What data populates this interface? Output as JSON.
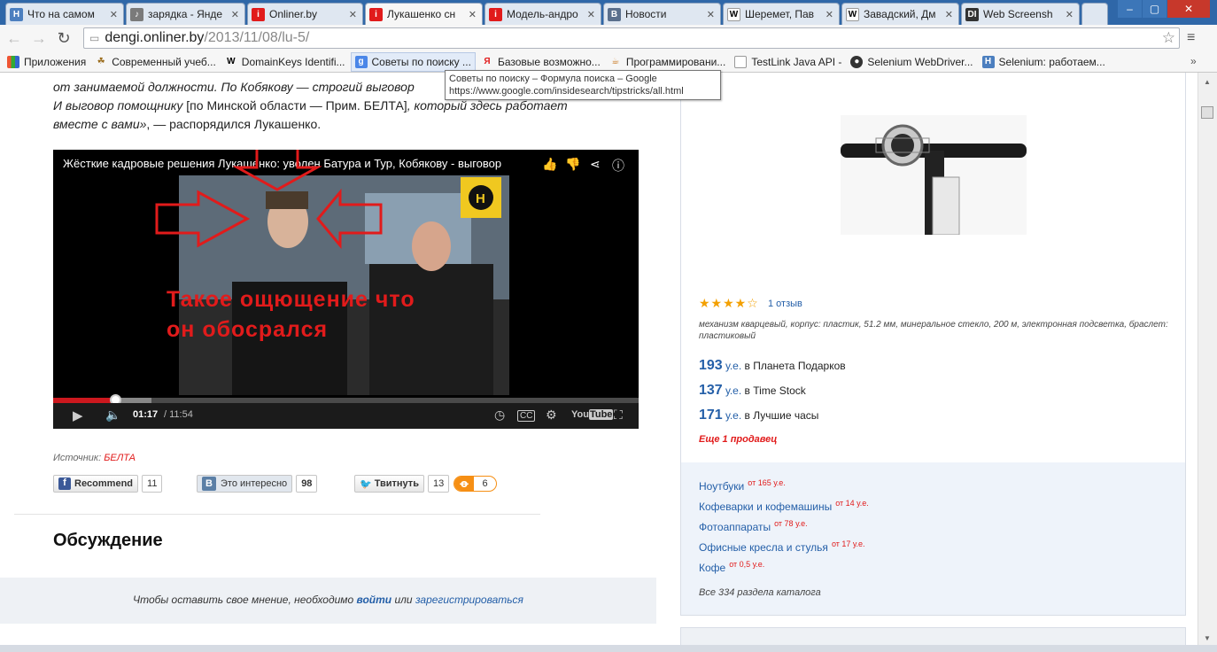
{
  "tabs": [
    {
      "label": "Что на самом",
      "icon": "H",
      "color": "#4c7fbf"
    },
    {
      "label": "зарядка - Янде",
      "icon": "speaker",
      "color": "#7a7a7a"
    },
    {
      "label": "Onliner.by",
      "icon": "onliner",
      "color": "#e11b1b"
    },
    {
      "label": "Лукашенко сн",
      "icon": "onliner",
      "color": "#e11b1b"
    },
    {
      "label": "Модель-андро",
      "icon": "onliner",
      "color": "#e11b1b"
    },
    {
      "label": "Новости",
      "icon": "B",
      "color": "#5a6f8c"
    },
    {
      "label": "Шеремет, Пав",
      "icon": "W",
      "color": "#ffffff"
    },
    {
      "label": "Завадский, Дм",
      "icon": "W",
      "color": "#ffffff"
    },
    {
      "label": "Web Screensh",
      "icon": "DI",
      "color": "#333333"
    }
  ],
  "window_controls": [
    "–",
    "▢",
    "✕"
  ],
  "address": {
    "host": "dengi.onliner.by",
    "path": "/2013/11/08/lu-5/"
  },
  "bookmarks": [
    {
      "label": "Приложения",
      "icon": "apps-grid-icon"
    },
    {
      "label": "Современный учеб...",
      "icon": "owl-icon"
    },
    {
      "label": "DomainKeys Identifi...",
      "icon": "W"
    },
    {
      "label": "Советы по поиску ...",
      "icon": "g"
    },
    {
      "label": "Базовые возможно...",
      "icon": "Я"
    },
    {
      "label": "Программировани...",
      "icon": "java-icon"
    },
    {
      "label": "TestLink Java API -",
      "icon": "page-icon"
    },
    {
      "label": "Selenium WebDriver...",
      "icon": "github-icon"
    },
    {
      "label": "Selenium: работаем...",
      "icon": "H"
    }
  ],
  "tooltip": {
    "title": "Советы по поиску – Формула поиска – Google",
    "url": "https://www.google.com/insidesearch/tipstricks/all.html"
  },
  "article": {
    "quote_line1_a": "от занимаемой должности. По Кобякову — строгий выговор",
    "quote_line2_a": "И выговор помощнику",
    "quote_line2_b": "[по Минской области — Прим. БЕЛТА]",
    "quote_line2_c": ", который здесь работает",
    "quote_line3_a": "вместе с вами»",
    "quote_line3_b": ", — распорядился Лукашенко.",
    "source_label": "Источник:",
    "source_name": "БЕЛТА"
  },
  "video": {
    "title": "Жёсткие кадровые решения Лукашенко: уволен Батура и Тур, Кобякову - выговор",
    "overlay": "Такое ощющение что\nон обосрался",
    "time": "01:17",
    "duration": "/ 11:54",
    "progress": 0.108
  },
  "share": {
    "fb_label": "Recommend",
    "fb_count": "11",
    "vk_label": "Это интересно",
    "vk_count": "98",
    "tw_label": "Твитнуть",
    "tw_count": "13",
    "ok_count": "6"
  },
  "discussion": {
    "title": "Обсуждение",
    "login_prefix": "Чтобы оставить свое мнение, необходимо",
    "login_link": "войти",
    "or": "или",
    "register_link": "зарегистрироваться"
  },
  "product": {
    "rating": 4,
    "stars": "★★★★☆",
    "reviews": "1 отзыв",
    "description": "механизм кварцевый, корпус: пластик, 51.2 мм, минеральное стекло, 200 м, электронная подсветка, браслет: пластиковый",
    "offers": [
      {
        "price": "193",
        "unit": "у.е.",
        "shop": "в Планета Подарков"
      },
      {
        "price": "137",
        "unit": "у.е.",
        "shop": "в Time Stock"
      },
      {
        "price": "171",
        "unit": "у.е.",
        "shop": "в Лучшие часы"
      }
    ],
    "more_sellers": "Еще 1 продавец"
  },
  "catalog": {
    "items": [
      {
        "name": "Ноутбуки",
        "price": "от 165 у.е."
      },
      {
        "name": "Кофеварки и кофемашины",
        "price": "от 14 у.е."
      },
      {
        "name": "Фотоаппараты",
        "price": "от 78 у.е."
      },
      {
        "name": "Офисные кресла и стулья",
        "price": "от 17 у.е."
      },
      {
        "name": "Кофе",
        "price": "от 0,5 у.е."
      }
    ],
    "all": "Все 334 раздела каталога"
  },
  "colors": {
    "accent": "#e11b1b",
    "link": "#245fa8",
    "tabbar": "#2f67a8"
  }
}
